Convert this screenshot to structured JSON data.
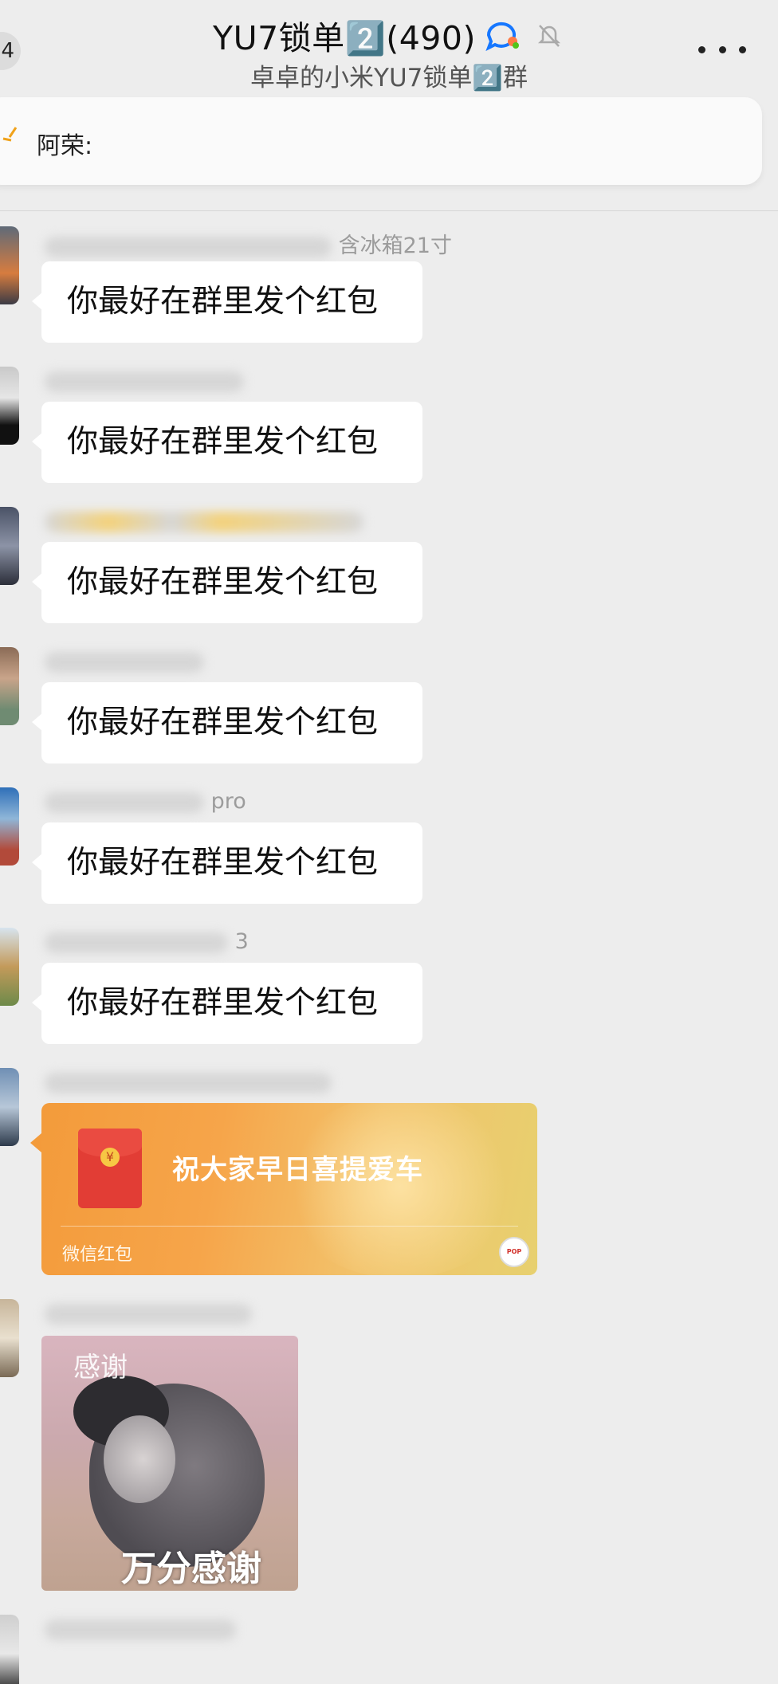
{
  "header": {
    "back_badge": "4",
    "title": "YU7锁单2️⃣(490)",
    "subtitle": "卓卓的小米YU7锁单2️⃣群",
    "more_icon": "more-dots-icon",
    "chat_icon": "chat-bubble-icon",
    "mute_icon": "bell-muted-icon"
  },
  "pinned": {
    "sender_label": "阿荣:"
  },
  "messages": [
    {
      "sender_visible": "含冰箱21寸",
      "text": "你最好在群里发个红包"
    },
    {
      "sender_visible": "",
      "text": "你最好在群里发个红包"
    },
    {
      "sender_visible": "",
      "text": "你最好在群里发个红包"
    },
    {
      "sender_visible": "",
      "text": "你最好在群里发个红包"
    },
    {
      "sender_visible": "pro",
      "text": "你最好在群里发个红包"
    },
    {
      "sender_visible": "3",
      "text": "你最好在群里发个红包"
    }
  ],
  "red_packet": {
    "title": "祝大家早日喜提爱车",
    "footer": "微信红包",
    "brand": "POP MART",
    "coin_symbol": "¥",
    "colors": {
      "start": "#f39b3b",
      "end": "#e7d06f"
    }
  },
  "sticker": {
    "top_text": "感谢",
    "bottom_text": "万分感谢"
  }
}
